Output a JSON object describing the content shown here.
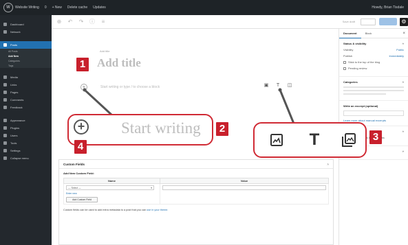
{
  "adminbar": {
    "site_name": "Website Writing",
    "comments_count": "0",
    "new_label": "+ New",
    "view_label": "Delete cache",
    "updates_label": "Updates",
    "howdy": "Howdy, Brian Tisdale"
  },
  "sidebar": {
    "items": [
      {
        "label": "Dashboard"
      },
      {
        "label": "Network"
      },
      {
        "label": "Posts",
        "active": true
      },
      {
        "label": "Media"
      },
      {
        "label": "Links"
      },
      {
        "label": "Pages"
      },
      {
        "label": "Comments"
      },
      {
        "label": "Feedback"
      },
      {
        "label": "Appearance"
      },
      {
        "label": "Plugins"
      },
      {
        "label": "Users"
      },
      {
        "label": "Tools"
      },
      {
        "label": "Settings"
      },
      {
        "label": "Collapse menu"
      }
    ],
    "subitems": [
      "All Posts",
      "Add New",
      "Categories",
      "Tags"
    ]
  },
  "editor": {
    "title_hint": "Add title",
    "title_placeholder": "Add title",
    "block_placeholder": "Start writing or type / to choose a block",
    "save_draft": "Save draft",
    "start_writing": "Start writing"
  },
  "panel": {
    "tab_document": "Document",
    "tab_block": "Block",
    "status_visibility": "Status & visibility",
    "visibility_label": "Visibility",
    "visibility_value": "Public",
    "publish_label": "Publish",
    "publish_value": "Immediately",
    "stick_label": "Stick to the top of the blog",
    "pending_label": "Pending review",
    "categories": "Categories",
    "excerpt_heading": "Write an excerpt (optional)",
    "discussion": "Discussion",
    "post_format": "Post Format",
    "learn_more": "Learn more about manual excerpts",
    "allow_pings": "Allow pingbacks & trackbacks"
  },
  "metabox": {
    "heading": "Custom Fields",
    "sub_heading": "Add New Custom Field:",
    "col_name": "Name",
    "col_value": "Value",
    "select_placeholder": "— Select —",
    "enter_new": "Enter new",
    "add_button": "Add Custom Field",
    "help_text": "Custom fields can be used to add extra metadata to a post that you can",
    "help_link": "use in your theme."
  },
  "badges": [
    "1",
    "2",
    "3",
    "4"
  ],
  "icons": [
    "image-icon",
    "text-T-icon",
    "gallery-icon",
    "plus-circle-icon"
  ],
  "colors": {
    "callout_red": "#c8202c",
    "admin_dark": "#1e2327",
    "sidebar_dark": "#23282d",
    "accent_blue": "#2271b1",
    "backdrop": "#cfe6f2"
  }
}
